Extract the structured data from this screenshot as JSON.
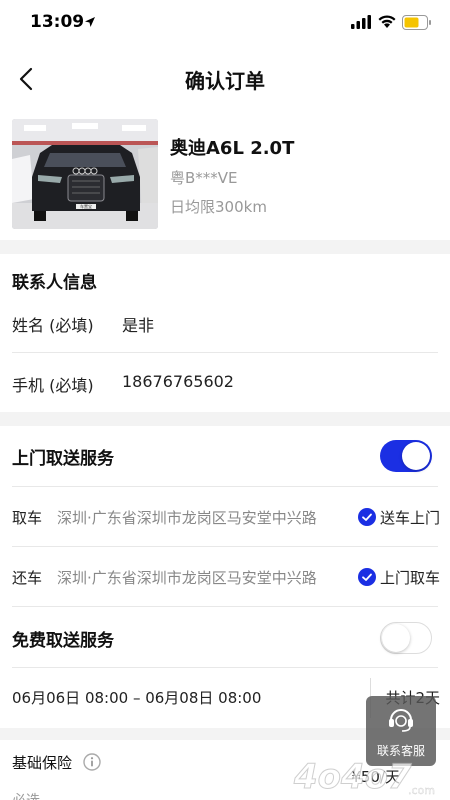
{
  "status_bar": {
    "time": "13:09"
  },
  "nav": {
    "title": "确认订单"
  },
  "car": {
    "name": "奥迪A6L 2.0T",
    "plate": "粤B***VE",
    "daily_limit": "日均限300km",
    "photo_sign": "车置宝"
  },
  "contact": {
    "title": "联系人信息",
    "name_label": "姓名 (必填)",
    "name_value": "是非",
    "phone_label": "手机 (必填)",
    "phone_value": "18676765602"
  },
  "door_service": {
    "title": "上门取送服务",
    "enabled": true,
    "pickup": {
      "label": "取车",
      "address": "深圳·广东省深圳市龙岗区马安堂中兴路",
      "option": "送车上门"
    },
    "return": {
      "label": "还车",
      "address": "深圳·广东省深圳市龙岗区马安堂中兴路",
      "option": "上门取车"
    }
  },
  "free_service": {
    "title": "免费取送服务",
    "enabled": false
  },
  "rental": {
    "dates": "06月06日 08:00 – 06月08日 08:00",
    "total": "共计2天"
  },
  "insurance": {
    "title": "基础保险",
    "price": "¥50/天",
    "note": "必选"
  },
  "customer_service": {
    "label": "联系客服"
  },
  "watermark": {
    "text": "4o4o7",
    "suffix": ".com"
  },
  "colors": {
    "accent": "#1b2fe3",
    "battery": "#f5c400"
  }
}
